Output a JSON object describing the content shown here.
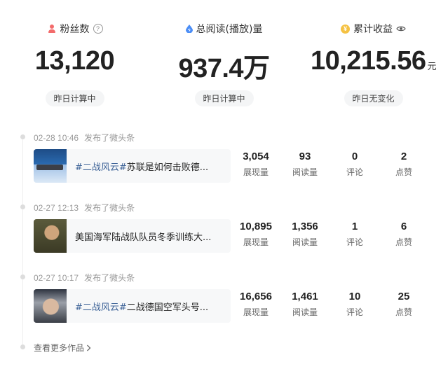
{
  "stats": [
    {
      "label": "粉丝数",
      "value": "13,120",
      "unit": "",
      "note": "昨日计算中",
      "icon": "person-icon",
      "extra_icon": "help-circle-icon",
      "icon_color": "#f36b6b"
    },
    {
      "label": "总阅读(播放)量",
      "value": "937.4万",
      "unit": "",
      "note": "昨日计算中",
      "icon": "drop-icon",
      "extra_icon": "",
      "icon_color": "#4a8df6"
    },
    {
      "label": "累计收益",
      "value": "10,215.56",
      "unit": "元",
      "note": "昨日无变化",
      "icon": "coin-icon",
      "extra_icon": "eye-icon",
      "icon_color": "#f5c243"
    }
  ],
  "entries": [
    {
      "time": "02-28 10:46",
      "action": "发布了微头条",
      "tag": "#二战风云#",
      "title": "苏联是如何击败德...",
      "metrics": [
        {
          "value": "3,054",
          "label": "展现量"
        },
        {
          "value": "93",
          "label": "阅读量"
        },
        {
          "value": "0",
          "label": "评论"
        },
        {
          "value": "2",
          "label": "点赞"
        }
      ]
    },
    {
      "time": "02-27 12:13",
      "action": "发布了微头条",
      "tag": "",
      "title": "美国海军陆战队队员冬季训练大...",
      "metrics": [
        {
          "value": "10,895",
          "label": "展现量"
        },
        {
          "value": "1,356",
          "label": "阅读量"
        },
        {
          "value": "1",
          "label": "评论"
        },
        {
          "value": "6",
          "label": "点赞"
        }
      ]
    },
    {
      "time": "02-27 10:17",
      "action": "发布了微头条",
      "tag": "#二战风云#",
      "title": "二战德国空军头号...",
      "metrics": [
        {
          "value": "16,656",
          "label": "展现量"
        },
        {
          "value": "1,461",
          "label": "阅读量"
        },
        {
          "value": "10",
          "label": "评论"
        },
        {
          "value": "25",
          "label": "点赞"
        }
      ]
    }
  ],
  "more_link": "查看更多作品",
  "colors": {
    "accent_tag": "#406599",
    "muted": "#999999"
  }
}
